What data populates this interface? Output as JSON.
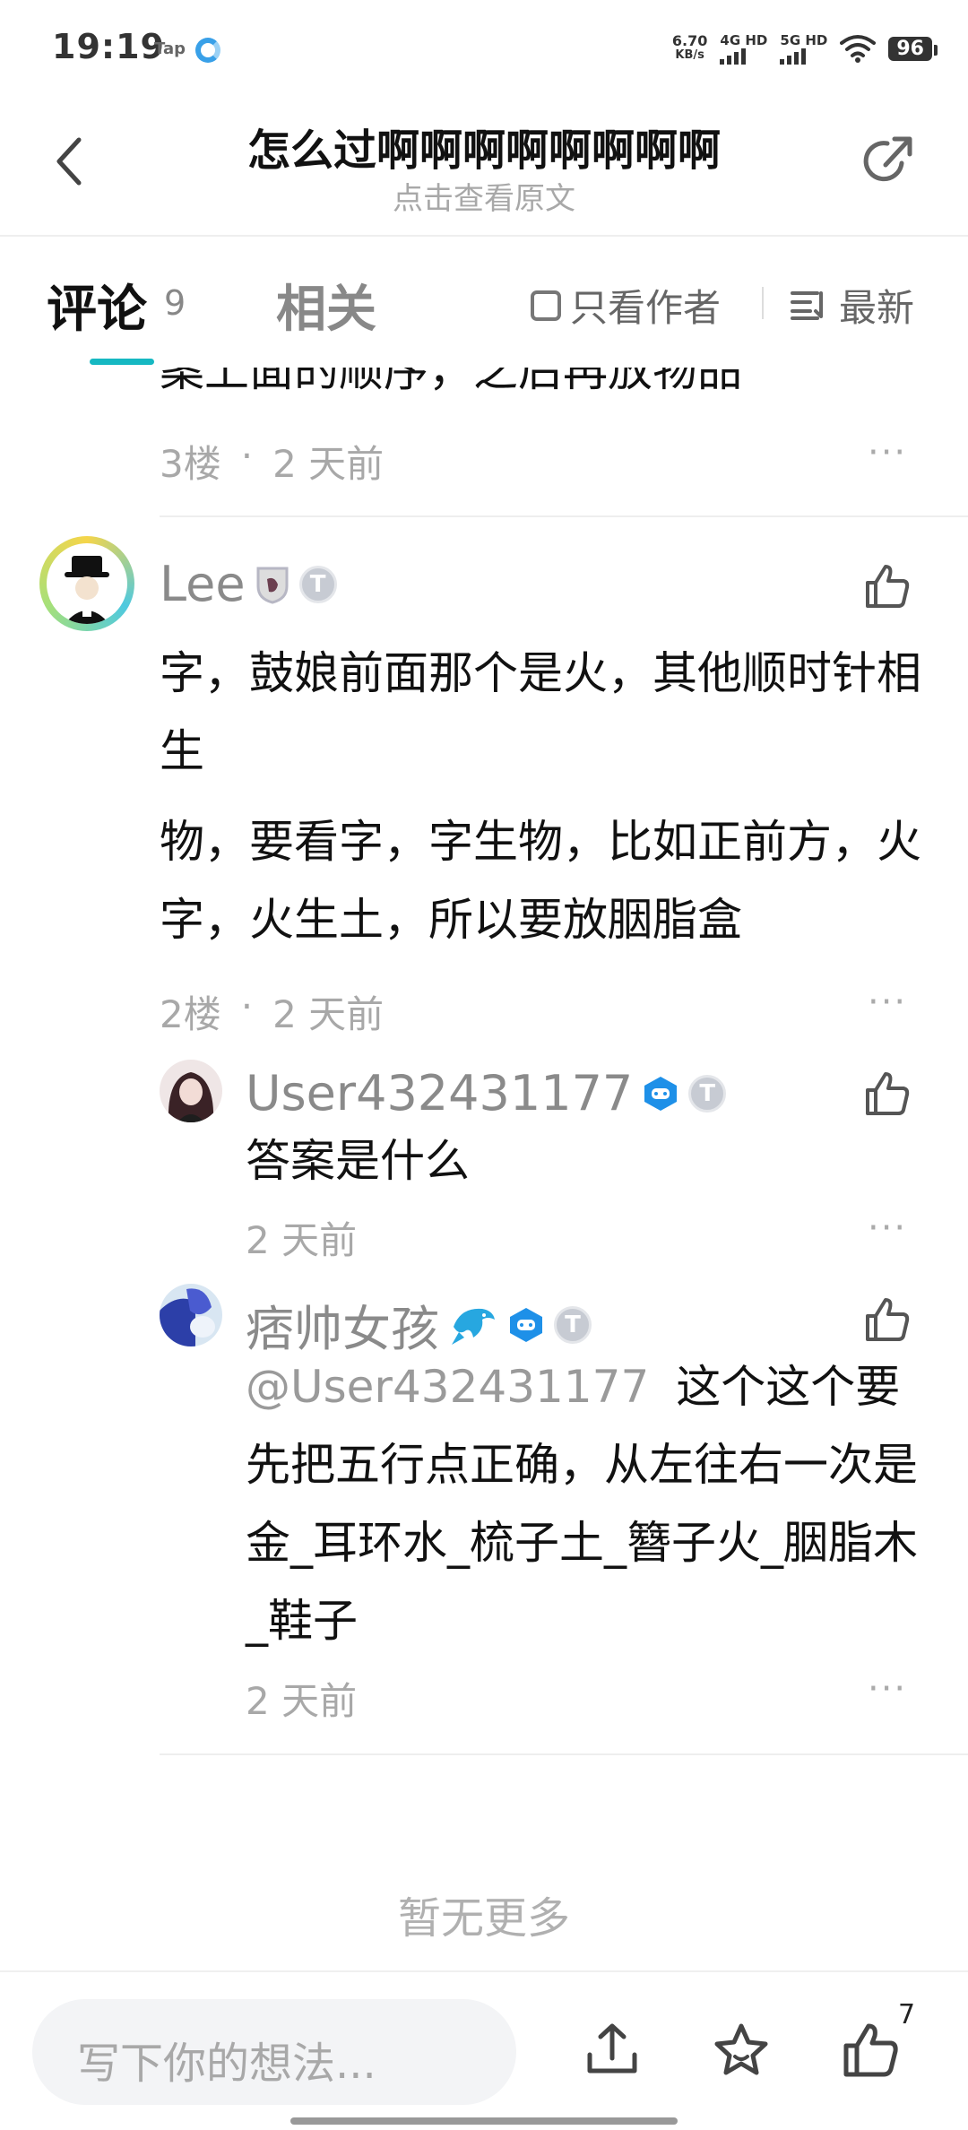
{
  "status_bar": {
    "time": "19:19",
    "app": "Tap",
    "net_speed_value": "6.70",
    "net_speed_unit": "KB/s",
    "sim1": "4G HD",
    "sim2": "5G HD",
    "battery": "96"
  },
  "header": {
    "title": "怎么过啊啊啊啊啊啊啊啊",
    "subtitle": "点击查看原文"
  },
  "tabs": {
    "comments_label": "评论",
    "comments_count": "9",
    "related_label": "相关",
    "author_only": "只看作者",
    "sort": "最新"
  },
  "comments": [
    {
      "text_partial": "案上面的顺序，之后再放物品",
      "floor": "3楼",
      "time": "2 天前"
    },
    {
      "username": "Lee",
      "paragraphs": [
        "字，鼓娘前面那个是火，其他顺时针相生",
        "物，要看字，字生物，比如正前方，火字，火生土，所以要放胭脂盒"
      ],
      "floor": "2楼",
      "time": "2 天前",
      "replies": [
        {
          "username": "User432431177",
          "text": "答案是什么",
          "time": "2 天前"
        },
        {
          "username": "痞帅女孩",
          "mention": "@User432431177",
          "text": "这个这个要先把五行点正确，从左往右一次是金_耳环水_梳子土_簪子火_胭脂木_鞋子",
          "time": "2 天前"
        }
      ]
    }
  ],
  "footer": {
    "no_more": "暂无更多",
    "input_placeholder": "写下你的想法...",
    "like_count": "7"
  },
  "badges": {
    "t1": "T",
    "t2": "T"
  },
  "icons": {
    "back": "chevron-left-icon",
    "share": "share-icon",
    "like": "thumbs-up-icon",
    "more": "more-dots-icon",
    "upload": "upload-icon",
    "star": "star-icon",
    "sort": "sort-list-icon"
  },
  "colors": {
    "accent": "#16b8c2",
    "badge_blue": "#1e90e8"
  }
}
